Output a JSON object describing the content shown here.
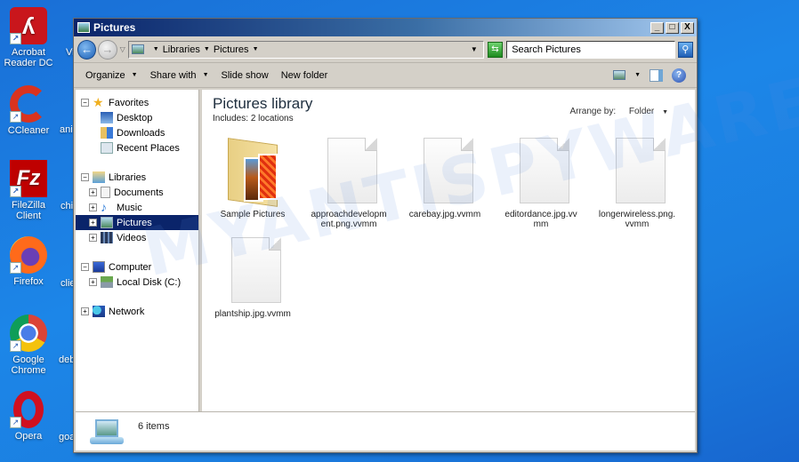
{
  "desktop": {
    "icons": [
      {
        "label": "Acrobat Reader DC",
        "icon": "acrobat-icon"
      },
      {
        "label": "CCleaner",
        "icon": "ccleaner-icon"
      },
      {
        "label": "FileZilla Client",
        "icon": "filezilla-icon"
      },
      {
        "label": "Firefox",
        "icon": "firefox-icon"
      },
      {
        "label": "Google Chrome",
        "icon": "chrome-icon"
      },
      {
        "label": "Opera",
        "icon": "opera-icon"
      }
    ],
    "partial_labels": [
      "Vi",
      "ani",
      "chi",
      "clie",
      "deb",
      "goa"
    ]
  },
  "window": {
    "title": "Pictures",
    "controls": {
      "minimize": "_",
      "maximize": "□",
      "close": "X"
    }
  },
  "address": {
    "breadcrumbs": [
      "Libraries",
      "Pictures"
    ],
    "search_placeholder": "Search Pictures"
  },
  "toolbar": {
    "organize": "Organize",
    "share_with": "Share with",
    "slide_show": "Slide show",
    "new_folder": "New folder"
  },
  "nav": {
    "favorites": {
      "label": "Favorites",
      "items": [
        "Desktop",
        "Downloads",
        "Recent Places"
      ]
    },
    "libraries": {
      "label": "Libraries",
      "items": [
        "Documents",
        "Music",
        "Pictures",
        "Videos"
      ],
      "selected": "Pictures"
    },
    "computer": {
      "label": "Computer",
      "items": [
        "Local Disk (C:)"
      ]
    },
    "network": {
      "label": "Network"
    }
  },
  "main": {
    "title": "Pictures library",
    "includes_label": "Includes:",
    "includes_value": "2 locations",
    "arrange_label": "Arrange by:",
    "arrange_value": "Folder",
    "items": [
      {
        "name": "Sample Pictures",
        "type": "folder"
      },
      {
        "name": "approachdevelopment.png.vvmm",
        "line1": "approachdevelopm",
        "line2": "ent.png.vvmm",
        "type": "file"
      },
      {
        "name": "carebay.jpg.vvmm",
        "line1": "carebay.jpg.vvmm",
        "line2": "",
        "type": "file"
      },
      {
        "name": "editordance.jpg.vvmm",
        "line1": "editordance.jpg.vv",
        "line2": "mm",
        "type": "file"
      },
      {
        "name": "longerwireless.png.vvmm",
        "line1": "longerwireless.png.",
        "line2": "vvmm",
        "type": "file"
      },
      {
        "name": "plantship.jpg.vvmm",
        "line1": "plantship.jpg.vvmm",
        "line2": "",
        "type": "file"
      }
    ]
  },
  "status": {
    "count_text": "6 items"
  },
  "watermark": "MYANTISPYWARE.COM"
}
